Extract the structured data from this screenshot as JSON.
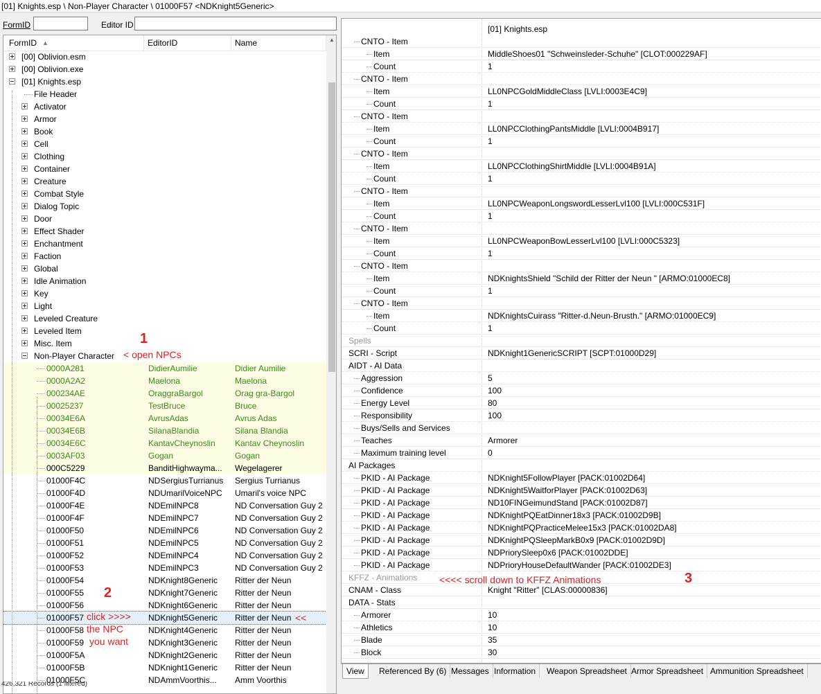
{
  "window": {
    "title": "[01] Knights.esp \\ Non-Player Character \\ 01000F57 <NDKnight5Generic>"
  },
  "filter": {
    "formid_label": "FormID",
    "formid_value": "",
    "editorid_label": "Editor ID",
    "editorid_value": ""
  },
  "tree": {
    "columns": [
      "FormID",
      "EditorID",
      "Name"
    ],
    "top": [
      {
        "label": "[00] Oblivion.esm",
        "collapsed": true
      },
      {
        "label": "[00] Oblivion.exe",
        "collapsed": true
      },
      {
        "label": "[01] Knights.esp",
        "collapsed": false
      }
    ],
    "groups": [
      {
        "label": "File Header",
        "leaf": true
      },
      {
        "label": "Activator"
      },
      {
        "label": "Armor"
      },
      {
        "label": "Book"
      },
      {
        "label": "Cell"
      },
      {
        "label": "Clothing"
      },
      {
        "label": "Container"
      },
      {
        "label": "Creature"
      },
      {
        "label": "Combat Style"
      },
      {
        "label": "Dialog Topic"
      },
      {
        "label": "Door"
      },
      {
        "label": "Effect Shader"
      },
      {
        "label": "Enchantment"
      },
      {
        "label": "Faction"
      },
      {
        "label": "Global"
      },
      {
        "label": "Idle Animation"
      },
      {
        "label": "Key"
      },
      {
        "label": "Light"
      },
      {
        "label": "Leveled Creature"
      },
      {
        "label": "Leveled Item"
      },
      {
        "label": "Misc. Item"
      },
      {
        "label": "Non-Player Character",
        "expanded": true
      }
    ],
    "npcs": [
      {
        "formid": "0000A281",
        "editorid": "DidierAumilie",
        "name": "Didier Aumilie",
        "style": "hl"
      },
      {
        "formid": "0000A2A2",
        "editorid": "Maelona",
        "name": "Maelona",
        "style": "hl"
      },
      {
        "formid": "000234AE",
        "editorid": "OraggraBargol",
        "name": "Orag gra-Bargol",
        "style": "hl"
      },
      {
        "formid": "00025237",
        "editorid": "TestBruce",
        "name": "Bruce",
        "style": "hl"
      },
      {
        "formid": "00034E6A",
        "editorid": "AvrusAdas",
        "name": "Avrus Adas",
        "style": "hl"
      },
      {
        "formid": "00034E6B",
        "editorid": "SilanaBlandia",
        "name": "Silana Blandia",
        "style": "hl"
      },
      {
        "formid": "00034E6C",
        "editorid": "KantavCheynoslin",
        "name": "Kantav Cheynoslin",
        "style": "hl"
      },
      {
        "formid": "0003AF03",
        "editorid": "Gogan",
        "name": "Gogan",
        "style": "hl"
      },
      {
        "formid": "000C5229",
        "editorid": "BanditHighwayma...",
        "name": "Wegelagerer",
        "style": "hlblk"
      },
      {
        "formid": "01000F4C",
        "editorid": "NDSergiusTurrianus",
        "name": "Sergius Turrianus",
        "style": ""
      },
      {
        "formid": "01000F4D",
        "editorid": "NDUmarilVoiceNPC",
        "name": "Umaril's voice NPC",
        "style": ""
      },
      {
        "formid": "01000F4E",
        "editorid": "NDEmilNPC8",
        "name": "ND Conversation Guy 2",
        "style": ""
      },
      {
        "formid": "01000F4F",
        "editorid": "NDEmilNPC7",
        "name": "ND Conversation Guy 2",
        "style": ""
      },
      {
        "formid": "01000F50",
        "editorid": "NDEmilNPC6",
        "name": "ND Conversation Guy 2",
        "style": ""
      },
      {
        "formid": "01000F51",
        "editorid": "NDEmilNPC5",
        "name": "ND Conversation Guy 2",
        "style": ""
      },
      {
        "formid": "01000F52",
        "editorid": "NDEmilNPC4",
        "name": "ND Conversation Guy 2",
        "style": ""
      },
      {
        "formid": "01000F53",
        "editorid": "NDEmilNPC3",
        "name": "ND Conversation Guy 2",
        "style": ""
      },
      {
        "formid": "01000F54",
        "editorid": "NDKnight8Generic",
        "name": "Ritter der Neun",
        "style": ""
      },
      {
        "formid": "01000F55",
        "editorid": "NDKnight7Generic",
        "name": "Ritter der Neun",
        "style": ""
      },
      {
        "formid": "01000F56",
        "editorid": "NDKnight6Generic",
        "name": "Ritter der Neun",
        "style": ""
      },
      {
        "formid": "01000F57",
        "editorid": "NDKnight5Generic",
        "name": "Ritter der Neun",
        "style": "sel"
      },
      {
        "formid": "01000F58",
        "editorid": "NDKnight4Generic",
        "name": "Ritter der Neun",
        "style": ""
      },
      {
        "formid": "01000F59",
        "editorid": "NDKnight3Generic",
        "name": "Ritter der Neun",
        "style": ""
      },
      {
        "formid": "01000F5A",
        "editorid": "NDKnight2Generic",
        "name": "Ritter der Neun",
        "style": ""
      },
      {
        "formid": "01000F5B",
        "editorid": "NDKnight1Generic",
        "name": "Ritter der Neun",
        "style": ""
      },
      {
        "formid": "01000F5C",
        "editorid": "NDAmmVoorthis...",
        "name": "Amm Voorthis",
        "style": ""
      }
    ]
  },
  "details": {
    "header": "[01] Knights.esp",
    "rows": [
      {
        "k": "CNTO - Item",
        "v": "",
        "indent": 1
      },
      {
        "k": "Item",
        "v": "MiddleShoes01 \"Schweinsleder-Schuhe\" [CLOT:000229AF]",
        "indent": 2
      },
      {
        "k": "Count",
        "v": "1",
        "indent": 2
      },
      {
        "k": "CNTO - Item",
        "v": "",
        "indent": 1
      },
      {
        "k": "Item",
        "v": "LL0NPCGoldMiddleClass [LVLI:0003E4C9]",
        "indent": 2
      },
      {
        "k": "Count",
        "v": "1",
        "indent": 2
      },
      {
        "k": "CNTO - Item",
        "v": "",
        "indent": 1
      },
      {
        "k": "Item",
        "v": "LL0NPCClothingPantsMiddle [LVLI:0004B917]",
        "indent": 2
      },
      {
        "k": "Count",
        "v": "1",
        "indent": 2
      },
      {
        "k": "CNTO - Item",
        "v": "",
        "indent": 1
      },
      {
        "k": "Item",
        "v": "LL0NPCClothingShirtMiddle [LVLI:0004B91A]",
        "indent": 2
      },
      {
        "k": "Count",
        "v": "1",
        "indent": 2
      },
      {
        "k": "CNTO - Item",
        "v": "",
        "indent": 1
      },
      {
        "k": "Item",
        "v": "LL0NPCWeaponLongswordLesserLvl100 [LVLI:000C531F]",
        "indent": 2
      },
      {
        "k": "Count",
        "v": "1",
        "indent": 2
      },
      {
        "k": "CNTO - Item",
        "v": "",
        "indent": 1
      },
      {
        "k": "Item",
        "v": "LL0NPCWeaponBowLesserLvl100 [LVLI:000C5323]",
        "indent": 2
      },
      {
        "k": "Count",
        "v": "1",
        "indent": 2
      },
      {
        "k": "CNTO - Item",
        "v": "",
        "indent": 1
      },
      {
        "k": "Item",
        "v": "NDKnightsShield \"Schild der Ritter der Neun \" [ARMO:01000EC8]",
        "indent": 2
      },
      {
        "k": "Count",
        "v": "1",
        "indent": 2
      },
      {
        "k": "CNTO - Item",
        "v": "",
        "indent": 1
      },
      {
        "k": "Item",
        "v": "NDKnightsCuirass \"Ritter-d.Neun-Brusth.\" [ARMO:01000EC9]",
        "indent": 2
      },
      {
        "k": "Count",
        "v": "1",
        "indent": 2
      },
      {
        "k": "Spells",
        "v": "",
        "indent": 0,
        "gray": true
      },
      {
        "k": "SCRI - Script",
        "v": "NDKnight1GenericSCRIPT [SCPT:01000D29]",
        "indent": 0
      },
      {
        "k": "AIDT - AI Data",
        "v": "",
        "indent": 0
      },
      {
        "k": "Aggression",
        "v": "5",
        "indent": 1
      },
      {
        "k": "Confidence",
        "v": "100",
        "indent": 1
      },
      {
        "k": "Energy Level",
        "v": "80",
        "indent": 1
      },
      {
        "k": "Responsibility",
        "v": "100",
        "indent": 1
      },
      {
        "k": "Buys/Sells and Services",
        "v": "",
        "indent": 1
      },
      {
        "k": "Teaches",
        "v": "Armorer",
        "indent": 1
      },
      {
        "k": "Maximum training level",
        "v": "0",
        "indent": 1
      },
      {
        "k": "AI Packages",
        "v": "",
        "indent": 0
      },
      {
        "k": "PKID - AI Package",
        "v": "NDKnight5FollowPlayer [PACK:01002D64]",
        "indent": 1
      },
      {
        "k": "PKID - AI Package",
        "v": "NDKnight5WaitforPlayer [PACK:01002D63]",
        "indent": 1
      },
      {
        "k": "PKID - AI Package",
        "v": "ND10FINGeimundStand [PACK:01002D87]",
        "indent": 1
      },
      {
        "k": "PKID - AI Package",
        "v": "NDKnightPQEatDinner18x3 [PACK:01002D9B]",
        "indent": 1
      },
      {
        "k": "PKID - AI Package",
        "v": "NDKnightPQPracticeMelee15x3 [PACK:01002DA8]",
        "indent": 1
      },
      {
        "k": "PKID - AI Package",
        "v": "NDKnightPQSleepMarkB0x9 [PACK:01002D9D]",
        "indent": 1
      },
      {
        "k": "PKID - AI Package",
        "v": "NDPriorySleep0x6 [PACK:01002DDE]",
        "indent": 1
      },
      {
        "k": "PKID - AI Package",
        "v": "NDPrioryHouseDefaultWander [PACK:01002DE3]",
        "indent": 1
      },
      {
        "k": "KFFZ - Animations",
        "v": "",
        "indent": 0,
        "gray": true
      },
      {
        "k": "CNAM - Class",
        "v": "Knight \"Ritter\" [CLAS:00000836]",
        "indent": 0
      },
      {
        "k": "DATA - Stats",
        "v": "",
        "indent": 0
      },
      {
        "k": "Armorer",
        "v": "10",
        "indent": 1
      },
      {
        "k": "Athletics",
        "v": "10",
        "indent": 1
      },
      {
        "k": "Blade",
        "v": "35",
        "indent": 1
      },
      {
        "k": "Block",
        "v": "30",
        "indent": 1
      }
    ]
  },
  "tabs": [
    "View",
    "Referenced By (6)",
    "Messages",
    "Information",
    "Weapon Spreadsheet",
    "Armor Spreadsheet",
    "Ammunition Spreadsheet"
  ],
  "annotations": {
    "n1": "1",
    "t1": "< open NPCs",
    "n2": "2",
    "t2a": "click  >>>>",
    "t2b": "the NPC",
    "t2c": "you want",
    "t2d": "<<",
    "n3": "3",
    "t3": "<<<< scroll down to  KFFZ Animations"
  },
  "status": "426,321 Records  (1 filtered)"
}
